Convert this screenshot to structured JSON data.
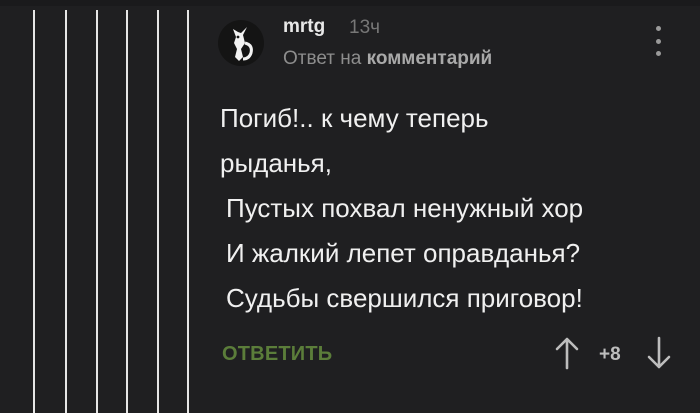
{
  "comment": {
    "author": "mrtg",
    "time": "13ч",
    "reply_prefix": "Ответ на",
    "reply_target": "комментарий",
    "lines": [
      "Погиб!.. к чему теперь",
      "рыданья,",
      "Пустых похвал ненужный хор",
      "И жалкий лепет оправданья?",
      "Судьбы свершился приговор!"
    ],
    "reply_label": "ОТВЕТИТЬ",
    "score": "+8"
  },
  "colors": {
    "background": "#1f1f21",
    "reply_accent": "#5b7d3a",
    "thread_lines": "#e6e6e6"
  },
  "icons": [
    "avatar-fox-icon",
    "more-vert-icon",
    "arrow-up-icon",
    "arrow-down-icon"
  ]
}
